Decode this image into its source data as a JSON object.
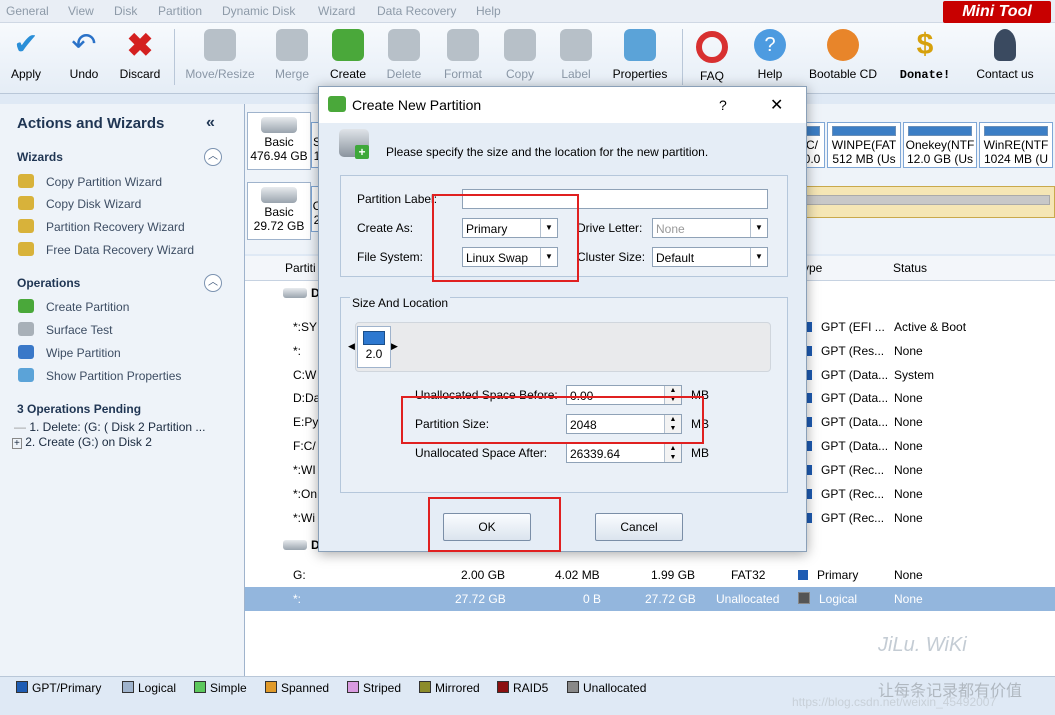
{
  "menu": [
    "General",
    "View",
    "Disk",
    "Partition",
    "Dynamic Disk",
    "Wizard",
    "Data Recovery",
    "Help"
  ],
  "logo": "Mini Tool",
  "toolbar": {
    "apply": "Apply",
    "undo": "Undo",
    "discard": "Discard",
    "move_resize": "Move/Resize",
    "merge": "Merge",
    "create": "Create",
    "delete": "Delete",
    "format": "Format",
    "copy": "Copy",
    "label": "Label",
    "properties": "Properties",
    "faq": "FAQ",
    "help": "Help",
    "bootable_cd": "Bootable CD",
    "donate": "Donate!",
    "contact_us": "Contact us"
  },
  "left_panel": {
    "title": "Actions and Wizards",
    "collapse_glyph": "«",
    "wizards_header": "Wizards",
    "wizards": [
      "Copy Partition Wizard",
      "Copy Disk Wizard",
      "Partition Recovery Wizard",
      "Free Data Recovery Wizard"
    ],
    "operations_header": "Operations",
    "operations": [
      "Create Partition",
      "Surface Test",
      "Wipe Partition",
      "Show Partition Properties"
    ],
    "pending_header": "3 Operations Pending",
    "pending": [
      "1. Delete: (G: ( Disk 2 Partition ...",
      "2. Create (G:) on Disk 2"
    ]
  },
  "disk_map": {
    "disk1_type": "Basic",
    "disk1_size": "476.94 GB",
    "disk2_type": "Basic",
    "disk2_size": "29.72 GB",
    "partitions": [
      {
        "line1": "C/",
        "line2": "0.0"
      },
      {
        "line1": "WINPE(FAT",
        "line2": "512 MB (Us"
      },
      {
        "line1": "Onekey(NTF",
        "line2": "12.0 GB (Us"
      },
      {
        "line1": "WinRE(NTF",
        "line2": "1024 MB (U"
      }
    ],
    "left_fragments": [
      "S",
      "1",
      "C",
      "2"
    ]
  },
  "table": {
    "headers": {
      "partition": "Partiti",
      "type": "ype",
      "status": "Status"
    },
    "rows": [
      {
        "name": "*:SY",
        "type": "GPT (EFI ...",
        "status": "Active & Boot"
      },
      {
        "name": "*:",
        "type": "GPT (Res...",
        "status": "None"
      },
      {
        "name": "C:W",
        "type": "GPT (Data...",
        "status": "System"
      },
      {
        "name": "D:Da",
        "type": "GPT (Data...",
        "status": "None"
      },
      {
        "name": "E:Py",
        "type": "GPT (Data...",
        "status": "None"
      },
      {
        "name": "F:C/",
        "type": "GPT (Data...",
        "status": "None"
      },
      {
        "name": "*:WI",
        "type": "GPT (Rec...",
        "status": "None"
      },
      {
        "name": "*:On",
        "type": "GPT (Rec...",
        "status": "None"
      },
      {
        "name": "*:Wi",
        "type": "GPT (Rec...",
        "status": "None"
      }
    ],
    "disk_rows": [
      {
        "name": "G:",
        "capacity": "2.00 GB",
        "used": "4.02 MB",
        "unused": "1.99 GB",
        "fs": "FAT32",
        "type": "Primary",
        "status": "None"
      },
      {
        "name": "*:",
        "capacity": "27.72 GB",
        "used": "0 B",
        "unused": "27.72 GB",
        "fs": "Unallocated",
        "type": "Logical",
        "status": "None"
      }
    ]
  },
  "legend": [
    "GPT/Primary",
    "Logical",
    "Simple",
    "Spanned",
    "Striped",
    "Mirrored",
    "RAID5",
    "Unallocated"
  ],
  "legend_colors": [
    "#1e5cb3",
    "#9fb3cc",
    "#5cc85c",
    "#e09a2a",
    "#d99be0",
    "#8c8c2a",
    "#8c1010",
    "#888888"
  ],
  "dialog": {
    "title": "Create New Partition",
    "help": "?",
    "close": "✕",
    "instruction": "Please specify the size and the location for the new partition.",
    "partition_label_lbl": "Partition Label:",
    "partition_label_val": "",
    "create_as_lbl": "Create As:",
    "create_as_val": "Primary",
    "drive_letter_lbl": "Drive Letter:",
    "drive_letter_val": "None",
    "file_system_lbl": "File System:",
    "file_system_val": "Linux Swap",
    "cluster_size_lbl": "Cluster Size:",
    "cluster_size_val": "Default",
    "size_location_lbl": "Size And Location",
    "slider_value": "2.0",
    "unalloc_before_lbl": "Unallocated Space Before:",
    "unalloc_before_val": "0.00",
    "partition_size_lbl": "Partition Size:",
    "partition_size_val": "2048",
    "unalloc_after_lbl": "Unallocated Space After:",
    "unalloc_after_val": "26339.64",
    "unit": "MB",
    "ok": "OK",
    "cancel": "Cancel"
  },
  "watermark": {
    "line1": "JiLu. WiKi",
    "line2": "让每条记录都有价值",
    "url": "https://blog.csdn.net/weixin_45492007"
  }
}
